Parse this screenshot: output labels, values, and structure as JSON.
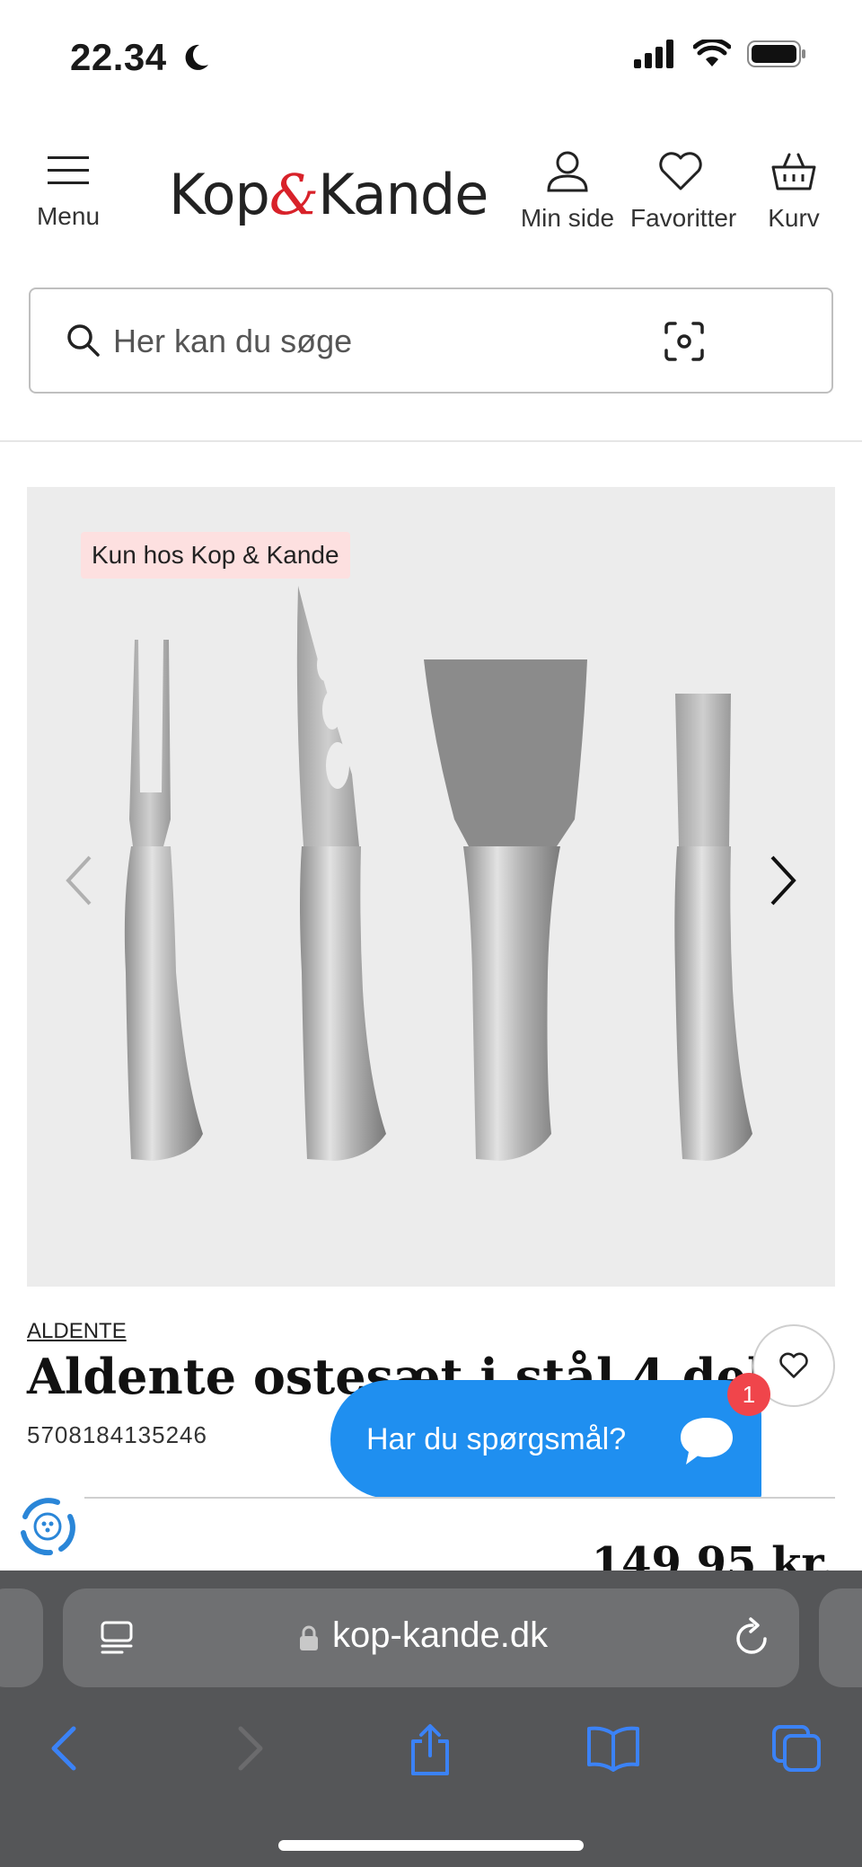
{
  "status": {
    "time": "22.34"
  },
  "header": {
    "menu_label": "Menu",
    "logo_left": "Kop",
    "logo_amp": "&",
    "logo_right": "Kande",
    "account_label": "Min side",
    "favorites_label": "Favoritter",
    "cart_label": "Kurv"
  },
  "search": {
    "placeholder": "Her kan du søge"
  },
  "product": {
    "badge": "Kun hos Kop & Kande",
    "brand": "ALDENTE",
    "title": "Aldente ostesæt i stål 4 dele",
    "sku": "5708184135246",
    "price": "149,95 kr."
  },
  "chat": {
    "label": "Har du spørgsmål?",
    "unread_count": "1"
  },
  "browser": {
    "url": "kop-kande.dk"
  },
  "colors": {
    "accent": "#d8222a",
    "chat": "#1f8ff0",
    "badge_bg": "#fde0e0",
    "safari_tint": "#3b82f6"
  }
}
